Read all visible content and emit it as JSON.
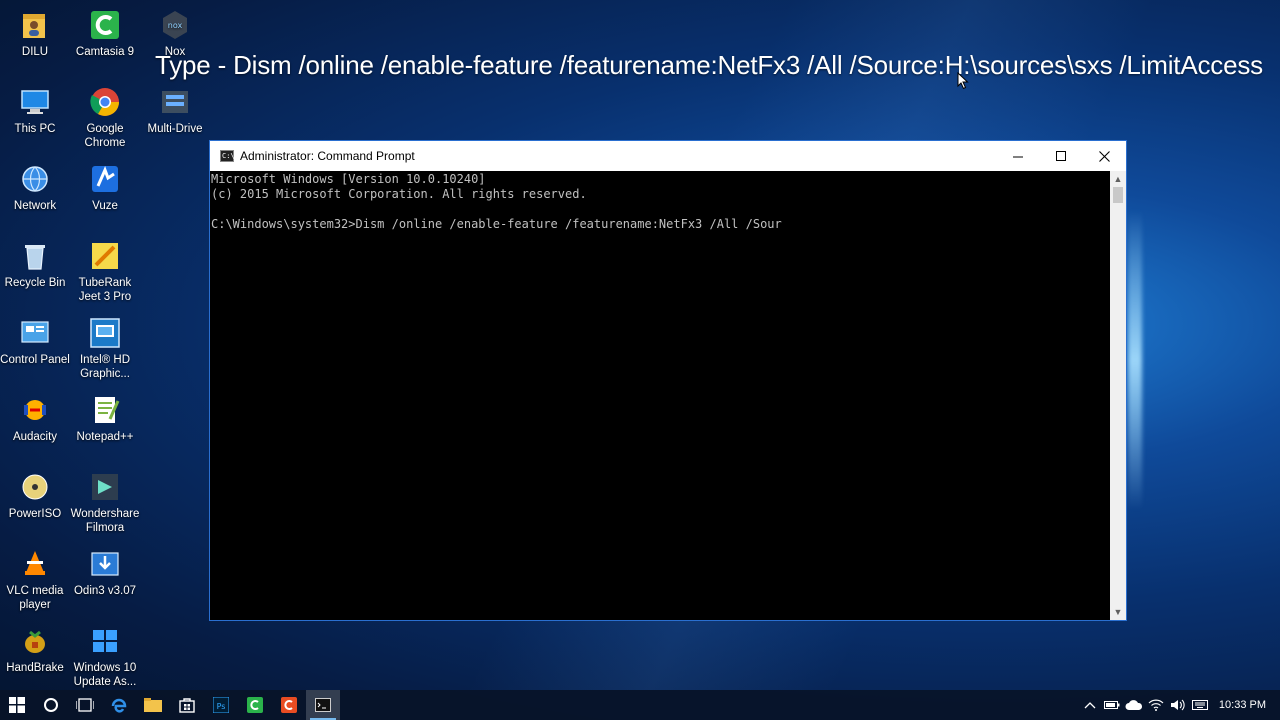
{
  "desktop": {
    "overlay_text": "Type - Dism /online /enable-feature /featurename:NetFx3 /All /Source:H:\\sources\\sxs /LimitAccess",
    "icons": [
      {
        "label": "DILU",
        "icon": "folder-user-icon"
      },
      {
        "label": "Camtasia 9",
        "icon": "camtasia-icon"
      },
      {
        "label": "Nox",
        "icon": "nox-icon"
      },
      {
        "label": "This PC",
        "icon": "this-pc-icon"
      },
      {
        "label": "Google Chrome",
        "icon": "chrome-icon"
      },
      {
        "label": "Multi-Drive",
        "icon": "multi-drive-icon"
      },
      {
        "label": "Network",
        "icon": "network-icon"
      },
      {
        "label": "Vuze",
        "icon": "vuze-icon"
      },
      {
        "label": "Recycle Bin",
        "icon": "recycle-bin-icon"
      },
      {
        "label": "TubeRank Jeet 3 Pro",
        "icon": "tuberank-icon"
      },
      {
        "label": "Control Panel",
        "icon": "control-panel-icon"
      },
      {
        "label": "Intel® HD Graphic...",
        "icon": "intel-graphics-icon"
      },
      {
        "label": "Audacity",
        "icon": "audacity-icon"
      },
      {
        "label": "Notepad++",
        "icon": "notepadpp-icon"
      },
      {
        "label": "PowerISO",
        "icon": "poweriso-icon"
      },
      {
        "label": "Wondershare Filmora",
        "icon": "filmora-icon"
      },
      {
        "label": "VLC media player",
        "icon": "vlc-icon"
      },
      {
        "label": "Odin3 v3.07",
        "icon": "odin-icon"
      },
      {
        "label": "HandBrake",
        "icon": "handbrake-icon"
      },
      {
        "label": "Windows 10 Update As...",
        "icon": "windows-update-icon"
      }
    ]
  },
  "cmd_window": {
    "title": "Administrator: Command Prompt",
    "console_lines": [
      "Microsoft Windows [Version 10.0.10240]",
      "(c) 2015 Microsoft Corporation. All rights reserved.",
      "",
      "C:\\Windows\\system32>Dism /online /enable-feature /featurename:NetFx3 /All /Sour"
    ]
  },
  "taskbar": {
    "clock": "10:33 PM"
  },
  "colors": {
    "accent": "#2a6fd0",
    "console_text": "#c0c0c0",
    "taskbar_bg": "#08142a"
  }
}
